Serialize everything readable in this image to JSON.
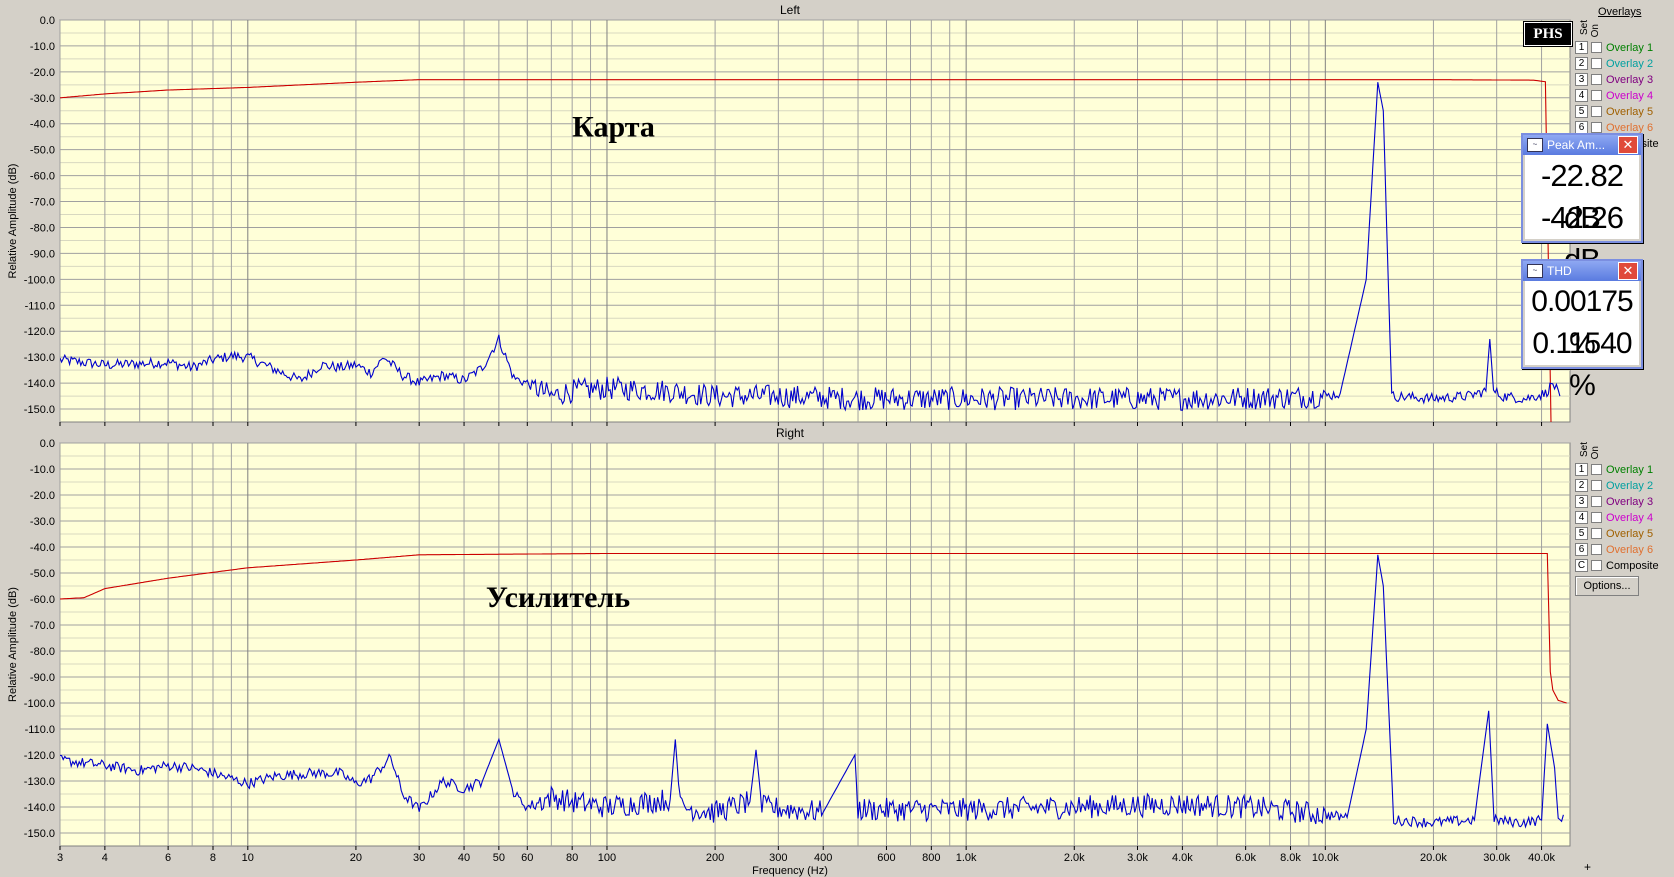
{
  "chart_data": [
    {
      "type": "line",
      "title": "Left",
      "xlabel": "",
      "ylabel": "Relative Amplitude (dB)",
      "xscale": "log",
      "xlim": [
        3,
        48000
      ],
      "ylim": [
        -155,
        0
      ],
      "yticks": [
        "0.0",
        "-10.0",
        "-20.0",
        "-30.0",
        "-40.0",
        "-50.0",
        "-60.0",
        "-70.0",
        "-80.0",
        "-90.0",
        "-100.0",
        "-110.0",
        "-120.0",
        "-130.0",
        "-140.0",
        "-150.0"
      ],
      "annotation": "Карта",
      "series": [
        {
          "color": "#cc0000",
          "points": [
            [
              3,
              -30
            ],
            [
              4,
              -28.5
            ],
            [
              6,
              -27
            ],
            [
              10,
              -26
            ],
            [
              20,
              -24
            ],
            [
              30,
              -23
            ],
            [
              100,
              -23
            ],
            [
              1000,
              -23
            ],
            [
              10000,
              -23
            ],
            [
              20000,
              -23
            ],
            [
              38000,
              -23.2
            ],
            [
              41000,
              -23.8
            ],
            [
              42500,
              -155
            ]
          ]
        },
        {
          "color": "#0000cc",
          "points": [
            [
              3,
              -131
            ],
            [
              4,
              -133
            ],
            [
              5,
              -132.5
            ],
            [
              6,
              -132
            ],
            [
              7,
              -134
            ],
            [
              8,
              -131
            ],
            [
              9,
              -129.5
            ],
            [
              10,
              -130
            ],
            [
              12,
              -135
            ],
            [
              14,
              -139
            ],
            [
              16,
              -133
            ],
            [
              18,
              -134
            ],
            [
              20,
              -133
            ],
            [
              22,
              -136
            ],
            [
              24,
              -130
            ],
            [
              27,
              -137
            ],
            [
              30,
              -140
            ],
            [
              35,
              -137
            ],
            [
              40,
              -139
            ],
            [
              45,
              -134
            ],
            [
              50,
              -123
            ],
            [
              55,
              -138
            ],
            [
              60,
              -140
            ],
            [
              70,
              -145
            ],
            [
              80,
              -143
            ],
            [
              100,
              -142
            ],
            [
              150,
              -143
            ],
            [
              200,
              -145
            ],
            [
              300,
              -145
            ],
            [
              500,
              -146
            ],
            [
              1000,
              -146
            ],
            [
              2000,
              -146
            ],
            [
              4000,
              -146
            ],
            [
              8000,
              -145.5
            ],
            [
              10000,
              -145
            ],
            [
              11000,
              -144
            ],
            [
              13000,
              -100
            ],
            [
              14000,
              -24
            ],
            [
              14500,
              -35
            ],
            [
              15300,
              -145
            ],
            [
              20000,
              -146
            ],
            [
              25000,
              -145
            ],
            [
              28000,
              -143
            ],
            [
              28700,
              -123
            ],
            [
              29400,
              -143
            ],
            [
              31000,
              -145
            ],
            [
              36000,
              -146
            ],
            [
              41000,
              -144
            ],
            [
              43000,
              -140
            ],
            [
              45000,
              -145
            ]
          ]
        }
      ]
    },
    {
      "type": "line",
      "title": "Right",
      "xlabel": "Frequency (Hz)",
      "ylabel": "Relative Amplitude (dB)",
      "xscale": "log",
      "xlim": [
        3,
        48000
      ],
      "ylim": [
        -155,
        0
      ],
      "yticks": [
        "0.0",
        "-10.0",
        "-20.0",
        "-30.0",
        "-40.0",
        "-50.0",
        "-60.0",
        "-70.0",
        "-80.0",
        "-90.0",
        "-100.0",
        "-110.0",
        "-120.0",
        "-130.0",
        "-140.0",
        "-150.0"
      ],
      "xticks": [
        {
          "v": 3,
          "l": "3"
        },
        {
          "v": 4,
          "l": "4"
        },
        {
          "v": 6,
          "l": "6"
        },
        {
          "v": 8,
          "l": "8"
        },
        {
          "v": 10,
          "l": "10"
        },
        {
          "v": 20,
          "l": "20"
        },
        {
          "v": 30,
          "l": "30"
        },
        {
          "v": 40,
          "l": "40"
        },
        {
          "v": 50,
          "l": "50"
        },
        {
          "v": 60,
          "l": "60"
        },
        {
          "v": 80,
          "l": "80"
        },
        {
          "v": 100,
          "l": "100"
        },
        {
          "v": 200,
          "l": "200"
        },
        {
          "v": 300,
          "l": "300"
        },
        {
          "v": 400,
          "l": "400"
        },
        {
          "v": 600,
          "l": "600"
        },
        {
          "v": 800,
          "l": "800"
        },
        {
          "v": 1000,
          "l": "1.0k"
        },
        {
          "v": 2000,
          "l": "2.0k"
        },
        {
          "v": 3000,
          "l": "3.0k"
        },
        {
          "v": 4000,
          "l": "4.0k"
        },
        {
          "v": 6000,
          "l": "6.0k"
        },
        {
          "v": 8000,
          "l": "8.0k"
        },
        {
          "v": 10000,
          "l": "10.0k"
        },
        {
          "v": 20000,
          "l": "20.0k"
        },
        {
          "v": 30000,
          "l": "30.0k"
        },
        {
          "v": 40000,
          "l": "40.0k"
        }
      ],
      "annotation": "Усилитель",
      "series": [
        {
          "color": "#cc0000",
          "points": [
            [
              3,
              -60
            ],
            [
              3.5,
              -59.5
            ],
            [
              4,
              -56
            ],
            [
              6,
              -52
            ],
            [
              10,
              -48
            ],
            [
              20,
              -45
            ],
            [
              30,
              -43
            ],
            [
              100,
              -42.5
            ],
            [
              1000,
              -42.5
            ],
            [
              10000,
              -42.5
            ],
            [
              20000,
              -42.5
            ],
            [
              40000,
              -42.5
            ],
            [
              41500,
              -42.5
            ],
            [
              42300,
              -88
            ],
            [
              43000,
              -95
            ],
            [
              44500,
              -99
            ],
            [
              47000,
              -100
            ]
          ]
        },
        {
          "color": "#0000cc",
          "points": [
            [
              3,
              -122
            ],
            [
              4,
              -124
            ],
            [
              5,
              -126
            ],
            [
              6,
              -124
            ],
            [
              7,
              -125
            ],
            [
              8,
              -127
            ],
            [
              10,
              -131
            ],
            [
              12,
              -128
            ],
            [
              15,
              -127
            ],
            [
              18,
              -127
            ],
            [
              20,
              -131
            ],
            [
              22,
              -129
            ],
            [
              25,
              -121
            ],
            [
              27,
              -135
            ],
            [
              30,
              -141
            ],
            [
              35,
              -130
            ],
            [
              40,
              -133
            ],
            [
              45,
              -130
            ],
            [
              50,
              -114
            ],
            [
              55,
              -135
            ],
            [
              60,
              -140
            ],
            [
              70,
              -136
            ],
            [
              80,
              -138
            ],
            [
              100,
              -140
            ],
            [
              150,
              -137
            ],
            [
              155,
              -114
            ],
            [
              160,
              -140
            ],
            [
              200,
              -142
            ],
            [
              250,
              -138
            ],
            [
              260,
              -118
            ],
            [
              270,
              -140
            ],
            [
              400,
              -142
            ],
            [
              490,
              -120
            ],
            [
              500,
              -141
            ],
            [
              1000,
              -141
            ],
            [
              2000,
              -140
            ],
            [
              4000,
              -139
            ],
            [
              6000,
              -140
            ],
            [
              8000,
              -141.5
            ],
            [
              10000,
              -143
            ],
            [
              11500,
              -144
            ],
            [
              13000,
              -110
            ],
            [
              14000,
              -43
            ],
            [
              14500,
              -55
            ],
            [
              15500,
              -145
            ],
            [
              20000,
              -146
            ],
            [
              26000,
              -145
            ],
            [
              28500,
              -103
            ],
            [
              29500,
              -145
            ],
            [
              35000,
              -146
            ],
            [
              40000,
              -145
            ],
            [
              41500,
              -108
            ],
            [
              43500,
              -125
            ],
            [
              44500,
              -145
            ],
            [
              46000,
              -143
            ]
          ]
        }
      ]
    }
  ],
  "sidebar": {
    "overlays_title": "Overlays",
    "col_set": "Set",
    "col_on": "On",
    "rows": [
      {
        "num": "1",
        "label": "Overlay 1",
        "color": "#008000"
      },
      {
        "num": "2",
        "label": "Overlay 2",
        "color": "#00a0a0"
      },
      {
        "num": "3",
        "label": "Overlay 3",
        "color": "#800080"
      },
      {
        "num": "4",
        "label": "Overlay 4",
        "color": "#cc00cc"
      },
      {
        "num": "5",
        "label": "Overlay 5",
        "color": "#a06000"
      },
      {
        "num": "6",
        "label": "Overlay 6",
        "color": "#e07030"
      },
      {
        "num": "C",
        "label": "Composite",
        "color": "#000000"
      }
    ],
    "options_label": "Options..."
  },
  "logo": "PHS",
  "peak_meter": {
    "title": "Peak Am...",
    "value_left": "-22.82 dB",
    "value_right": "-42.26 dB"
  },
  "thd_meter": {
    "title": "THD",
    "value_left": "0.00175 %",
    "value_right": "0.11540 %"
  },
  "corner_mark": "+"
}
